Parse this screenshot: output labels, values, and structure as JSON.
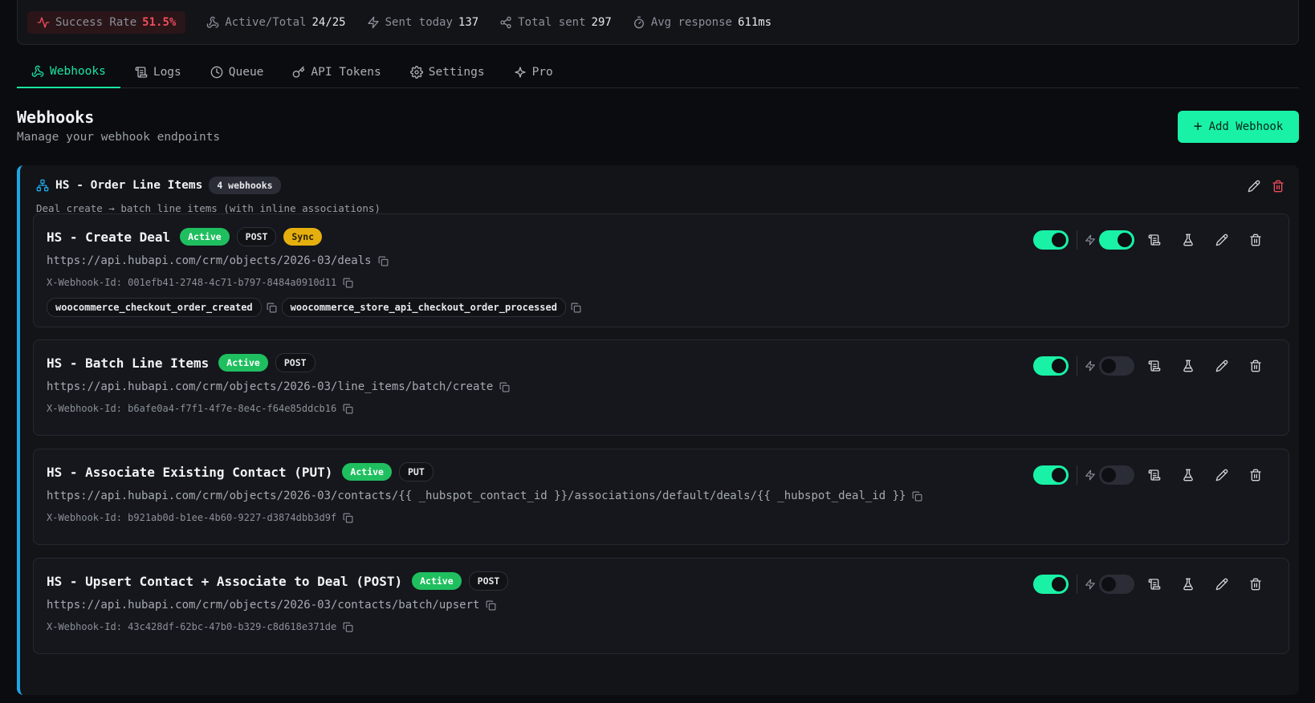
{
  "stats": {
    "success_label": "Success Rate",
    "success_value": "51.5%",
    "active_label": "Active/Total",
    "active_value": "24/25",
    "sent_today_label": "Sent today",
    "sent_today_value": "137",
    "total_sent_label": "Total sent",
    "total_sent_value": "297",
    "avg_label": "Avg response",
    "avg_value": "611ms"
  },
  "tabs": [
    {
      "label": "Webhooks",
      "icon": "webhook-icon",
      "active": true
    },
    {
      "label": "Logs",
      "icon": "scroll-icon",
      "active": false
    },
    {
      "label": "Queue",
      "icon": "clock-icon",
      "active": false
    },
    {
      "label": "API Tokens",
      "icon": "key-icon",
      "active": false
    },
    {
      "label": "Settings",
      "icon": "gear-icon",
      "active": false
    },
    {
      "label": "Pro",
      "icon": "sparkles-icon",
      "active": false
    }
  ],
  "header": {
    "title": "Webhooks",
    "subtitle": "Manage your webhook endpoints",
    "add_label": "Add Webhook"
  },
  "group": {
    "name": "HS - Order Line Items",
    "count": "4 webhooks",
    "description": "Deal create → batch line items (with inline associations)"
  },
  "webhooks": [
    {
      "name": "HS - Create Deal",
      "status": "Active",
      "method": "POST",
      "sync": "Sync",
      "url": "https://api.hubapi.com/crm/objects/2026-03/deals",
      "webhook_id": "X-Webhook-Id: 001efb41-2748-4c71-b797-8484a0910d11",
      "events": [
        "woocommerce_checkout_order_created",
        "woocommerce_store_api_checkout_order_processed"
      ],
      "enabled": true,
      "sync_enabled": true
    },
    {
      "name": "HS - Batch Line Items",
      "status": "Active",
      "method": "POST",
      "url": "https://api.hubapi.com/crm/objects/2026-03/line_items/batch/create",
      "webhook_id": "X-Webhook-Id: b6afe0a4-f7f1-4f7e-8e4c-f64e85ddcb16",
      "enabled": true,
      "sync_enabled": false
    },
    {
      "name": "HS - Associate Existing Contact (PUT)",
      "status": "Active",
      "method": "PUT",
      "url": "https://api.hubapi.com/crm/objects/2026-03/contacts/{{ _hubspot_contact_id }}/associations/default/deals/{{ _hubspot_deal_id }}",
      "webhook_id": "X-Webhook-Id: b921ab0d-b1ee-4b60-9227-d3874dbb3d9f",
      "enabled": true,
      "sync_enabled": false
    },
    {
      "name": "HS - Upsert Contact + Associate to Deal (POST)",
      "status": "Active",
      "method": "POST",
      "url": "https://api.hubapi.com/crm/objects/2026-03/contacts/batch/upsert",
      "webhook_id": "X-Webhook-Id: 43c428df-62bc-47b0-b329-c8d618e371de",
      "enabled": true,
      "sync_enabled": false
    }
  ],
  "colors": {
    "accent": "#19f2a6",
    "danger": "#ef4d5a",
    "group_border": "#1ea7e6",
    "active_badge": "#1fbf5f",
    "sync_badge": "#e5b00f"
  }
}
